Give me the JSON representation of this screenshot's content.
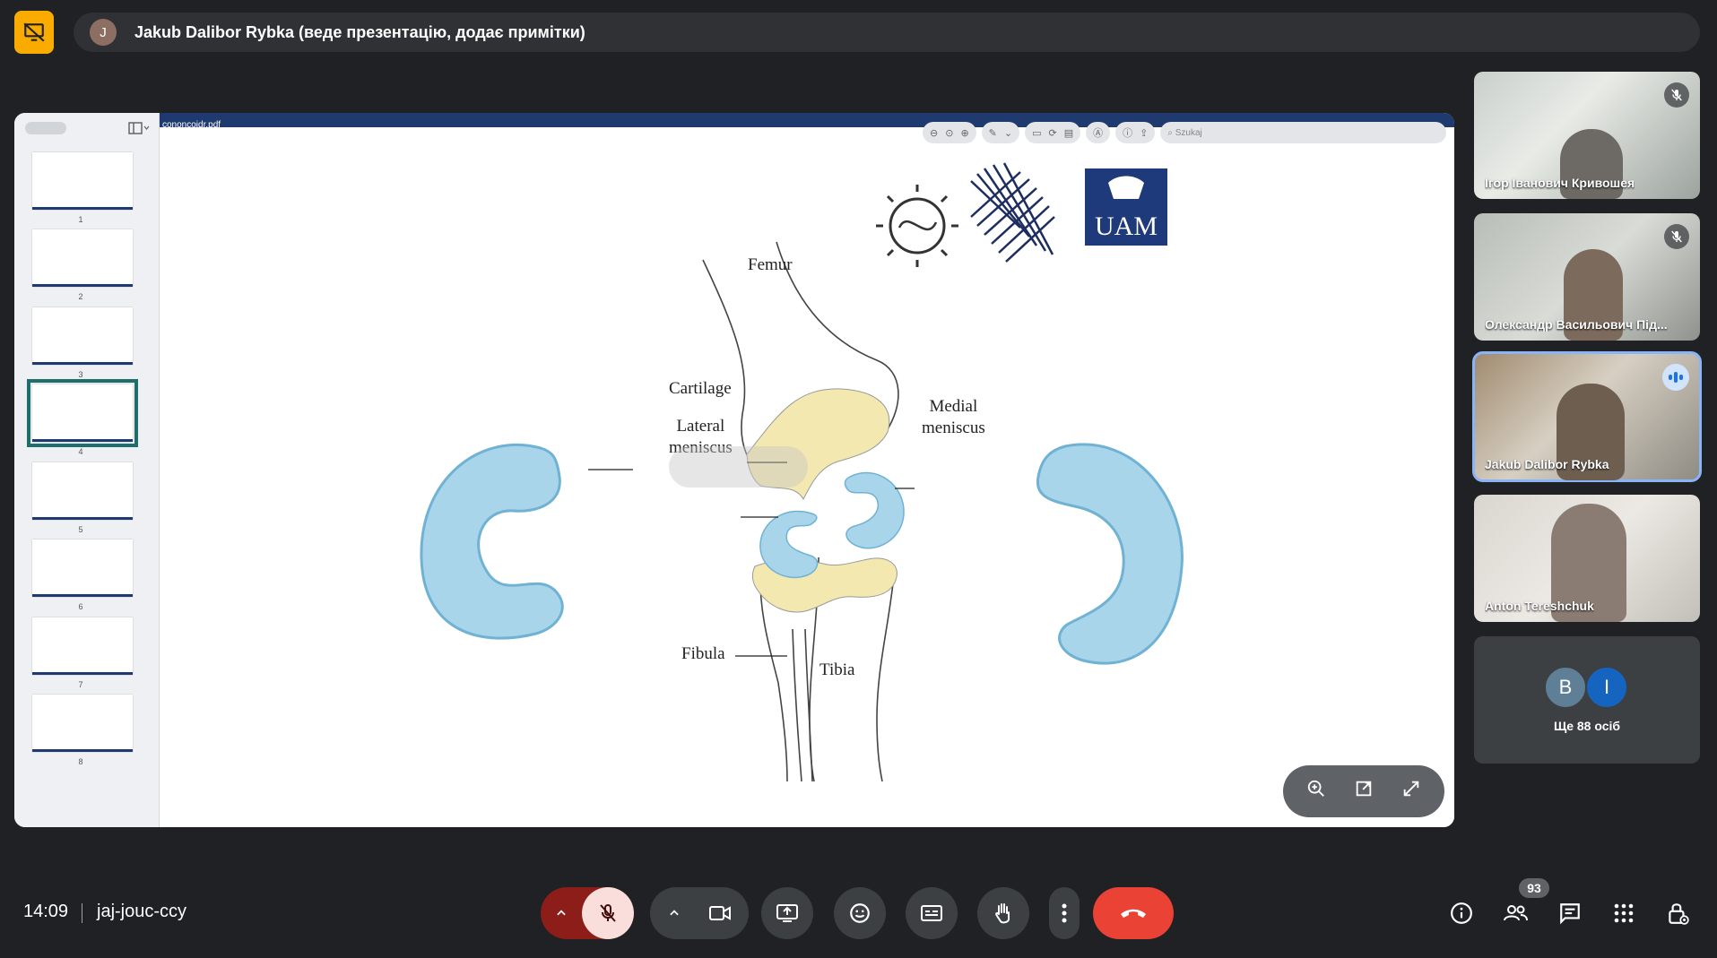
{
  "presenter": {
    "initial": "J",
    "text": "Jakub Dalibor Rybka (веде презентацію, додає примітки)"
  },
  "pdf": {
    "filename": "cononcojdr.pdf",
    "search_placeholder": "Szukaj"
  },
  "thumbnails": [
    {
      "num": "1"
    },
    {
      "num": "2"
    },
    {
      "num": "3"
    },
    {
      "num": "4",
      "selected": true
    },
    {
      "num": "5"
    },
    {
      "num": "6"
    },
    {
      "num": "7"
    },
    {
      "num": "8"
    }
  ],
  "slide": {
    "labels": {
      "femur": "Femur",
      "cartilage": "Cartilage",
      "lateral": "Lateral\nmeniscus",
      "medial": "Medial\nmeniscus",
      "fibula": "Fibula",
      "tibia": "Tibia"
    },
    "logos": {
      "uam": "UAM"
    }
  },
  "participants": [
    {
      "name": "Ігор Іванович Кривошея",
      "muted": true
    },
    {
      "name": "Олександр Васильович Під...",
      "muted": true
    },
    {
      "name": "Jakub Dalibor Rybka",
      "speaking": true
    },
    {
      "name": "Anton Tereshchuk",
      "muted": false
    }
  ],
  "others": {
    "avatars": [
      "B",
      "I"
    ],
    "text": "Ще 88 осіб"
  },
  "meeting": {
    "time": "14:09",
    "code": "jaj-jouc-ccy",
    "participant_count": "93"
  },
  "colors": {
    "end_call": "#ea4335",
    "mic_off_bg": "#f9dedc",
    "accent": "#8ab4f8",
    "meniscus": "#a9d5ea",
    "cartilage": "#f2e8b0"
  }
}
